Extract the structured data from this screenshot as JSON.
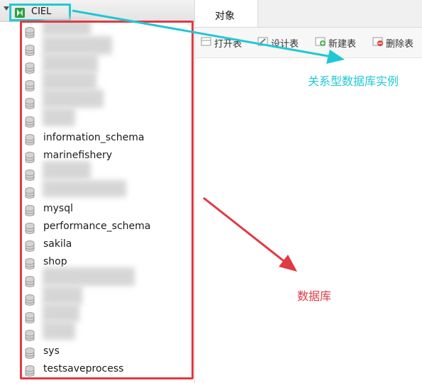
{
  "connection": {
    "name": "CIEL",
    "highlight_color": "#20c8d4"
  },
  "databases": {
    "highlight_color": "#e03a44",
    "items": [
      {
        "label": "",
        "redacted": true
      },
      {
        "label": "",
        "redacted": true
      },
      {
        "label": "",
        "redacted": true
      },
      {
        "label": "",
        "redacted": true
      },
      {
        "label": "",
        "redacted": true
      },
      {
        "label": "",
        "redacted": true
      },
      {
        "label": "information_schema",
        "redacted": false
      },
      {
        "label": "marinefishery",
        "redacted": false
      },
      {
        "label": "",
        "redacted": true
      },
      {
        "label": "",
        "redacted": true
      },
      {
        "label": "mysql",
        "redacted": false
      },
      {
        "label": "performance_schema",
        "redacted": false
      },
      {
        "label": "sakila",
        "redacted": false
      },
      {
        "label": "shop",
        "redacted": false
      },
      {
        "label": "",
        "redacted": true
      },
      {
        "label": "",
        "redacted": true
      },
      {
        "label": "",
        "redacted": true
      },
      {
        "label": "",
        "redacted": true
      },
      {
        "label": "sys",
        "redacted": false
      },
      {
        "label": "testsaveprocess",
        "redacted": false
      }
    ]
  },
  "tabs": [
    {
      "label": "对象"
    }
  ],
  "toolbar": {
    "open_table": "打开表",
    "design_table": "设计表",
    "new_table": "新建表",
    "delete_table": "删除表"
  },
  "annotations": {
    "instance_label": "关系型数据库实例",
    "instance_color": "#20c8d4",
    "database_label": "数据库",
    "database_color": "#e03a44"
  }
}
